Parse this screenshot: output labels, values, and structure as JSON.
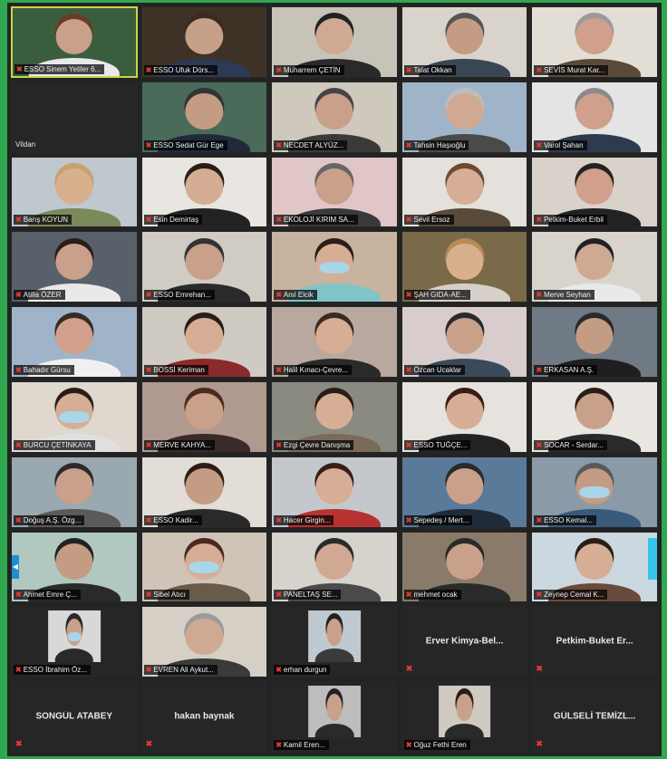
{
  "tiles": [
    {
      "name": "ESSO Sinem Yetiler 6...",
      "video": true,
      "bg": "#3a5e3d",
      "skin": "#c9a08a",
      "hair": "#6a3b26",
      "shirt": "#e9e9e9",
      "active": true
    },
    {
      "name": "ESSO Ufuk Dörs...",
      "video": true,
      "bg": "#3e3226",
      "skin": "#c7a088",
      "hair": "#3b2a20",
      "shirt": "#2d3a55"
    },
    {
      "name": "Muharrem ÇETİN",
      "video": true,
      "bg": "#c7c3b8",
      "skin": "#d0a992",
      "hair": "#222222",
      "shirt": "#2a2a2a"
    },
    {
      "name": "Talat Okkan",
      "video": true,
      "bg": "#d8d4cc",
      "skin": "#c49c84",
      "hair": "#555555",
      "shirt": "#3b4654"
    },
    {
      "name": "SEVİS Murat Kar...",
      "video": true,
      "bg": "#e2ded6",
      "skin": "#d0a08c",
      "hair": "#9a9a9a",
      "shirt": "#5a4a3a"
    },
    {
      "name": "Vildan",
      "video": false,
      "kind": "plain"
    },
    {
      "name": "ESSO Sedat Gür Ege",
      "video": true,
      "bg": "#4a6a5a",
      "skin": "#c49c84",
      "hair": "#333333",
      "shirt": "#1f2b3b"
    },
    {
      "name": "NECDET ALYÜZ...",
      "video": true,
      "bg": "#cfc8bd",
      "skin": "#c9a08a",
      "hair": "#444444",
      "shirt": "#3a3a3a"
    },
    {
      "name": "Tahsin Haşıoğlu",
      "video": true,
      "bg": "#9fb4c8",
      "skin": "#d0a992",
      "hair": "#bcbcbc",
      "shirt": "#4a4a4a"
    },
    {
      "name": "Varol Şahan",
      "video": true,
      "bg": "#e4e4e4",
      "skin": "#d0a08c",
      "hair": "#8a8a8a",
      "shirt": "#2e3a4e"
    },
    {
      "name": "Barış KOYUN",
      "video": true,
      "bg": "#bfc7cf",
      "skin": "#d9b08e",
      "hair": "#c9a070",
      "shirt": "#7a8a5a"
    },
    {
      "name": "Esin Demirtaş",
      "video": true,
      "bg": "#e9e5e0",
      "skin": "#d5ad95",
      "hair": "#2a1d17",
      "shirt": "#222222"
    },
    {
      "name": "EKOLOJİ KIRIM SA...",
      "video": true,
      "bg": "#e0c6c6",
      "skin": "#c9a08a",
      "hair": "#666666",
      "shirt": "#3a3a3a"
    },
    {
      "name": "Sevil Ersoz",
      "video": true,
      "bg": "#e4e0dc",
      "skin": "#d6ae96",
      "hair": "#6d4a30",
      "shirt": "#5a4a3a"
    },
    {
      "name": "Petkim-Buket Erbil",
      "video": true,
      "bg": "#d8d2ca",
      "skin": "#d0a08c",
      "hair": "#222222",
      "shirt": "#222222"
    },
    {
      "name": "Atilla ÖZER",
      "video": true,
      "bg": "#58606a",
      "skin": "#c9a08a",
      "hair": "#2a1d17",
      "shirt": "#e9e9e9"
    },
    {
      "name": "ESSO Emrehan...",
      "video": true,
      "bg": "#d0ccc4",
      "skin": "#c9a08a",
      "hair": "#333333",
      "shirt": "#2a2a2a"
    },
    {
      "name": "Anıl Elcik",
      "video": true,
      "bg": "#c7b3a0",
      "skin": "#d6ae96",
      "hair": "#2a1d17",
      "shirt": "#7fc4c8",
      "mask": true
    },
    {
      "name": "ŞAH GIDA-AE...",
      "video": true,
      "bg": "#7a6a4a",
      "skin": "#d9b08e",
      "hair": "#b98a5a",
      "shirt": "#d6d0c8"
    },
    {
      "name": "Merve Seyhan",
      "video": true,
      "bg": "#d8d4cc",
      "skin": "#d0a992",
      "hair": "#222222",
      "shirt": "#e9e9e9"
    },
    {
      "name": "Bahadır Gürsu",
      "video": true,
      "bg": "#9fb4c8",
      "skin": "#d0a08c",
      "hair": "#3a2a20",
      "shirt": "#f0f0f0"
    },
    {
      "name": "BOSSİ Keriman",
      "video": true,
      "bg": "#cfcac2",
      "skin": "#d6ae96",
      "hair": "#2a1d17",
      "shirt": "#8a2a2a"
    },
    {
      "name": "Halil Kınacı-Çevre...",
      "video": true,
      "bg": "#b8a8a0",
      "skin": "#d6ae96",
      "hair": "#3a2a20",
      "shirt": "#2a2a2a"
    },
    {
      "name": "Özcan Ucaklar",
      "video": true,
      "bg": "#d8cccc",
      "skin": "#c9a08a",
      "hair": "#2a2a2a",
      "shirt": "#3a4a5a"
    },
    {
      "name": "ERKASAN A.Ş.",
      "video": true,
      "bg": "#707a84",
      "skin": "#c49c84",
      "hair": "#2a2a2a",
      "shirt": "#1f1f1f"
    },
    {
      "name": "BURCU ÇETİNKAYA",
      "video": true,
      "bg": "#ded8cf",
      "skin": "#d6ae96",
      "hair": "#2a1d17",
      "shirt": "#e0e0e0",
      "mask": true
    },
    {
      "name": "MERVE KAHYA...",
      "video": true,
      "bg": "#b09a90",
      "skin": "#c9a08a",
      "hair": "#4a2a20",
      "shirt": "#3a2a2a"
    },
    {
      "name": "Ezgi Çevre Danışma",
      "video": true,
      "bg": "#8a8a80",
      "skin": "#d6ae96",
      "hair": "#2a1d17",
      "shirt": "#7a6a5a"
    },
    {
      "name": "ESSO TUĞÇE...",
      "video": true,
      "bg": "#e6e2de",
      "skin": "#d6ae96",
      "hair": "#3a1d17",
      "shirt": "#222222"
    },
    {
      "name": "SOCAR - Serdar...",
      "video": true,
      "bg": "#e9e6e2",
      "skin": "#c9a08a",
      "hair": "#2a1d17",
      "shirt": "#2a2a2a"
    },
    {
      "name": "Doğuş A.Ş. Özg...",
      "video": true,
      "bg": "#9aa8b0",
      "skin": "#c9a08a",
      "hair": "#2a2a2a",
      "shirt": "#5a5a5a"
    },
    {
      "name": "ESSO Kadir...",
      "video": true,
      "bg": "#e2ddd6",
      "skin": "#c49c84",
      "hair": "#2a1d17",
      "shirt": "#2a2a2a"
    },
    {
      "name": "Hacer Girgin...",
      "video": true,
      "bg": "#c4c8cc",
      "skin": "#d6ae96",
      "hair": "#3a1d17",
      "shirt": "#b83232"
    },
    {
      "name": "Sepedeş / Mert...",
      "video": true,
      "bg": "#5a7a9a",
      "skin": "#c9a08a",
      "hair": "#2a2a2a",
      "shirt": "#1f2b3b"
    },
    {
      "name": "ESSO Kemal...",
      "video": true,
      "bg": "#8a9aa8",
      "skin": "#c49c84",
      "hair": "#5a5a5a",
      "shirt": "#3a5a7a",
      "mask": true
    },
    {
      "name": "Ahmet Emre Ç...",
      "video": true,
      "bg": "#b0c8c0",
      "skin": "#c49c84",
      "hair": "#222222",
      "shirt": "#2a2a2a",
      "arrow": true
    },
    {
      "name": "Sibel Atıcı",
      "video": true,
      "bg": "#d0c4b8",
      "skin": "#d6ae96",
      "hair": "#4a2a20",
      "shirt": "#6a5a4a",
      "mask": true
    },
    {
      "name": "PANELTAŞ SE...",
      "video": true,
      "bg": "#d6d2cc",
      "skin": "#d0a992",
      "hair": "#2a2a2a",
      "shirt": "#4a4a4a"
    },
    {
      "name": "mehmet ocak",
      "video": true,
      "bg": "#8a7a6a",
      "skin": "#c9a08a",
      "hair": "#2a2a2a",
      "shirt": "#2a2a2a"
    },
    {
      "name": "Zeynep Cemal K...",
      "video": true,
      "bg": "#cbd8e0",
      "skin": "#d6ae96",
      "hair": "#2a1d17",
      "shirt": "#6a4a3a",
      "strip": true
    },
    {
      "name": "ESSO İbrahim Öz...",
      "video": false,
      "kind": "thumb",
      "bg": "#d8d8d8",
      "skin": "#c9a08a",
      "hair": "#2a2a2a",
      "shirt": "#2a2a2a",
      "mask": true
    },
    {
      "name": "EVREN Ali Aykut...",
      "video": true,
      "bg": "#d6cfc6",
      "skin": "#d0a992",
      "hair": "#9a9a9a",
      "shirt": "#3a3a3a"
    },
    {
      "name": "erhan durgun",
      "video": false,
      "kind": "thumb",
      "bg": "#c0c8d0",
      "skin": "#c9a08a",
      "hair": "#222222",
      "shirt": "#3a3a3a"
    },
    {
      "name": "Erver Kimya-Bel...",
      "video": false,
      "kind": "center"
    },
    {
      "name": "Petkim-Buket Er...",
      "video": false,
      "kind": "center"
    },
    {
      "name": "SONGÜL ATABEY",
      "video": false,
      "kind": "center"
    },
    {
      "name": "hakan baynak",
      "video": false,
      "kind": "center"
    },
    {
      "name": "Kamil Eren...",
      "video": false,
      "kind": "thumb",
      "bg": "#bdbdbd",
      "skin": "#c9a08a",
      "hair": "#222222",
      "shirt": "#2a2a2a"
    },
    {
      "name": "Oğuz Fethi Eren",
      "video": false,
      "kind": "thumb",
      "bg": "#cfcac2",
      "skin": "#c9a08a",
      "hair": "#2a1d17",
      "shirt": "#2a2a2a"
    },
    {
      "name": "GÜLSELİ TEMİZL...",
      "video": false,
      "kind": "center"
    }
  ]
}
